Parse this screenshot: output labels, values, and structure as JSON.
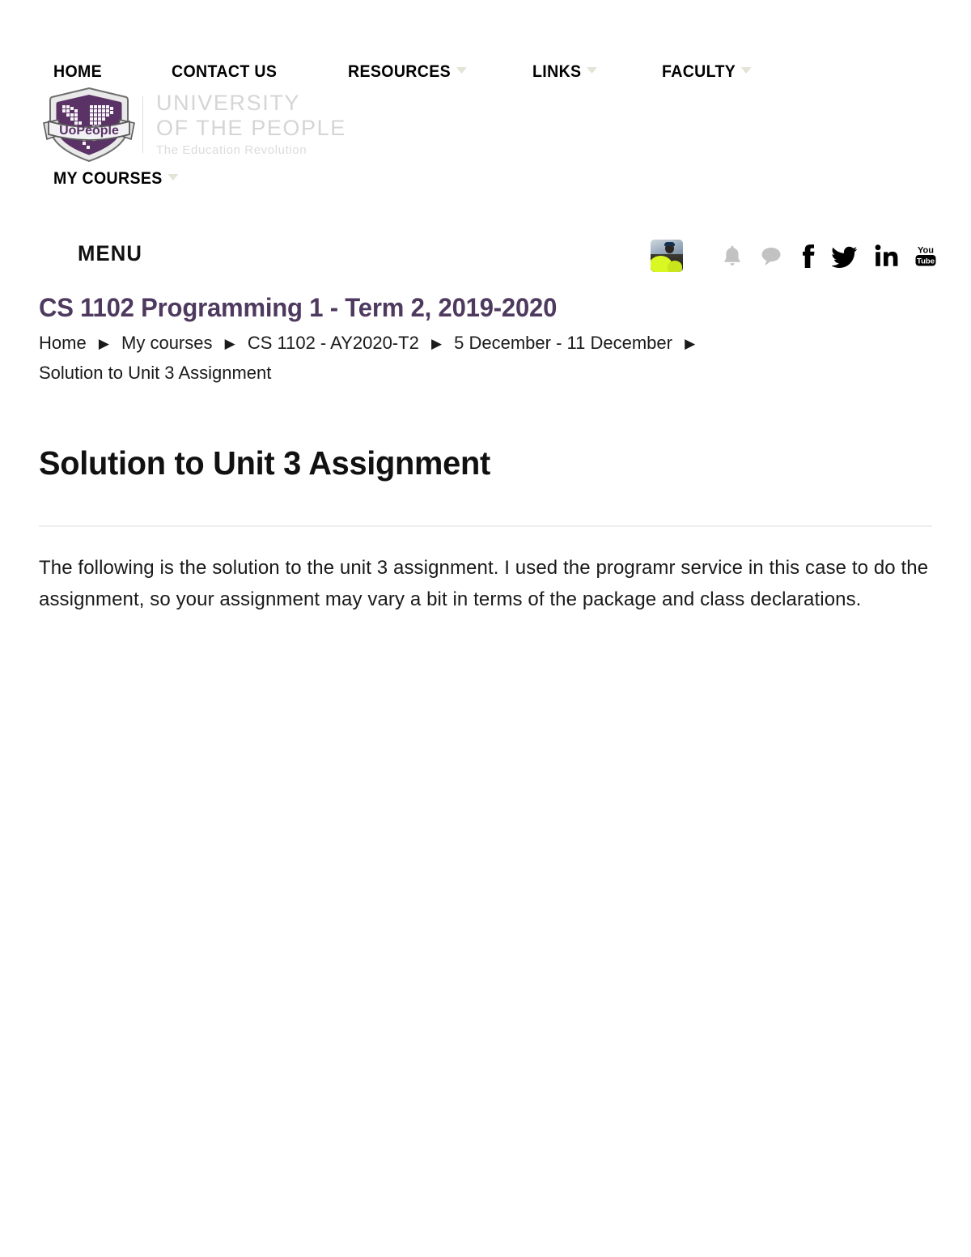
{
  "site": {
    "brand": {
      "logo_alt": "UoPeople shield logo",
      "shield_text": "UoPeople",
      "line1": "UNIVERSITY",
      "line2": "OF THE PEOPLE",
      "line3": "The Education Revolution",
      "shield_color": "#5b3266",
      "wordmark_color": "#d5d5d5"
    },
    "nav": {
      "items": [
        {
          "label": "HOME",
          "has_caret": false
        },
        {
          "label": "CONTACT US",
          "has_caret": false
        },
        {
          "label": "RESOURCES",
          "has_caret": true
        },
        {
          "label": "LINKS",
          "has_caret": true
        },
        {
          "label": "FACULTY",
          "has_caret": true
        }
      ],
      "my_courses": {
        "label": "MY COURSES",
        "has_caret": true
      },
      "caret_color": "#e4e3d6"
    }
  },
  "menubar": {
    "menu_label": "MENU",
    "icons": [
      {
        "name": "avatar",
        "label": "User profile picture"
      },
      {
        "name": "bell-icon",
        "label": "Notifications",
        "color": "#c2c2c2"
      },
      {
        "name": "chat-icon",
        "label": "Messages",
        "color": "#c2c2c2"
      },
      {
        "name": "facebook-icon",
        "label": "Facebook",
        "color": "#000000"
      },
      {
        "name": "twitter-icon",
        "label": "Twitter",
        "color": "#000000"
      },
      {
        "name": "linkedin-icon",
        "label": "LinkedIn",
        "color": "#000000"
      },
      {
        "name": "youtube-icon",
        "label": "YouTube",
        "color": "#000000"
      }
    ]
  },
  "course": {
    "title": "CS 1102 Programming 1 - Term 2, 2019-2020",
    "title_color": "#4f3a5f"
  },
  "breadcrumb": {
    "separator": "▶",
    "items": [
      "Home",
      "My courses",
      "CS 1102 - AY2020-T2",
      "5 December - 11 December",
      "Solution to Unit 3 Assignment"
    ]
  },
  "page": {
    "heading": "Solution to Unit 3 Assignment",
    "paragraph": "The following is the solution to the unit 3 assignment. I used the programr service in this case to do the assignment, so your assignment may vary a bit in terms of the package and class declarations."
  }
}
